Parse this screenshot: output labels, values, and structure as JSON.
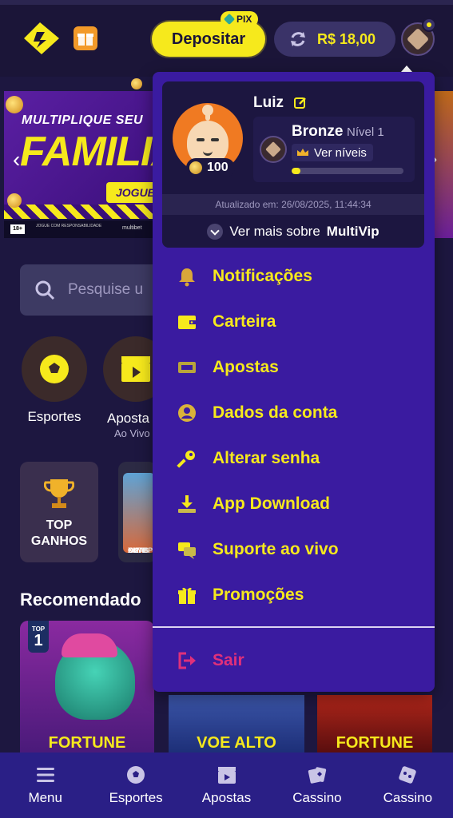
{
  "header": {
    "deposit_label": "Depositar",
    "pix_label": "PIX",
    "balance": "R$ 18,00",
    "brand_color": "#f6e91c"
  },
  "background": {
    "banner": {
      "line1": "MULTIPLIQUE SEU",
      "line2": "FAMILIA",
      "cta": "JOGUE",
      "footer": "JOGUE COM RESPONSABILIDADE",
      "age_badge": "18+",
      "footer_brand": "multibet"
    },
    "search_placeholder": "Pesquise u",
    "quick_links": [
      {
        "label": "Esportes",
        "sub": ""
      },
      {
        "label": "Aposta",
        "sub": "Ao Vivo"
      }
    ],
    "top_card_label_line1": "TOP",
    "top_card_label_line2": "GANHOS",
    "gate_card_text_line1": "GATE",
    "gate_card_text_line2": "OLYMP",
    "gate_card_text_line3": "XMAS",
    "section_title": "Recomendado",
    "top_badge_text": "TOP",
    "top_badge_number": "1",
    "games": [
      "FORTUNE",
      "VOE ALTO",
      "FORTUNE"
    ]
  },
  "profile": {
    "name": "Luiz",
    "points": "100",
    "tier": "Bronze",
    "level": "Nível 1",
    "ver_niveis": "Ver níveis",
    "progress_fraction": 0.08,
    "updated": "Atualizado em: 26/08/2025, 11:44:34",
    "ver_mais_prefix": "Ver mais sobre",
    "ver_mais_brand": "MultiVip"
  },
  "menu": {
    "items": [
      {
        "label": "Notificações",
        "icon": "bell-icon"
      },
      {
        "label": "Carteira",
        "icon": "wallet-icon"
      },
      {
        "label": "Apostas",
        "icon": "ticket-icon"
      },
      {
        "label": "Dados da conta",
        "icon": "user-circle-icon"
      },
      {
        "label": "Alterar senha",
        "icon": "key-icon"
      },
      {
        "label": "App Download",
        "icon": "download-icon"
      },
      {
        "label": "Suporte ao vivo",
        "icon": "chat-icon"
      },
      {
        "label": "Promoções",
        "icon": "gift-icon"
      }
    ],
    "logout_label": "Sair"
  },
  "bottom_nav": [
    {
      "label": "Menu",
      "icon": "hamburger-icon"
    },
    {
      "label": "Esportes",
      "icon": "soccer-ball-icon"
    },
    {
      "label": "Apostas",
      "icon": "clapper-icon"
    },
    {
      "label": "Cassino",
      "icon": "cards-icon"
    },
    {
      "label": "Cassino",
      "icon": "dice-icon"
    }
  ]
}
